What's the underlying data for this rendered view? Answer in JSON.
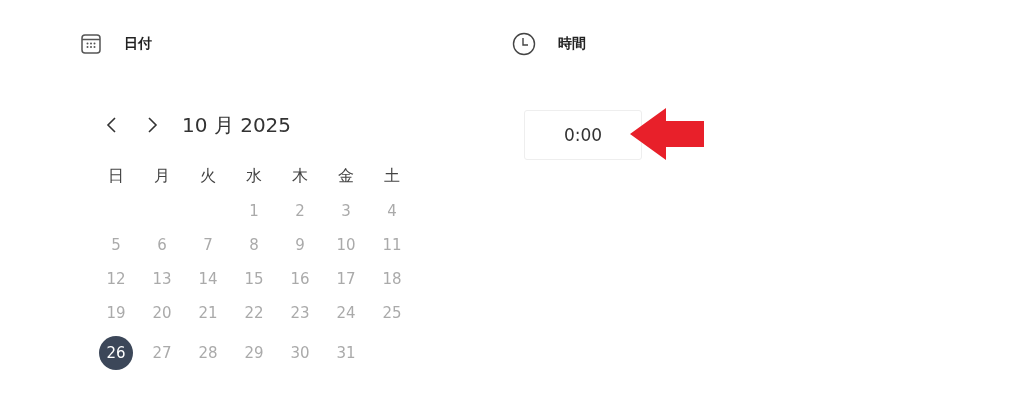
{
  "date_section": {
    "title": "日付",
    "month_label": "10 月 2025",
    "weekdays": [
      "日",
      "月",
      "火",
      "水",
      "木",
      "金",
      "土"
    ],
    "weeks": [
      [
        {
          "day": "1",
          "selected": false
        },
        {
          "day": "2",
          "selected": false
        },
        {
          "day": "3",
          "selected": false
        },
        {
          "day": "4",
          "selected": false
        }
      ],
      [
        {
          "day": "5",
          "selected": false
        },
        {
          "day": "6",
          "selected": false
        },
        {
          "day": "7",
          "selected": false
        },
        {
          "day": "8",
          "selected": false
        },
        {
          "day": "9",
          "selected": false
        },
        {
          "day": "10",
          "selected": false
        },
        {
          "day": "11",
          "selected": false
        }
      ],
      [
        {
          "day": "12",
          "selected": false
        },
        {
          "day": "13",
          "selected": false
        },
        {
          "day": "14",
          "selected": false
        },
        {
          "day": "15",
          "selected": false
        },
        {
          "day": "16",
          "selected": false
        },
        {
          "day": "17",
          "selected": false
        },
        {
          "day": "18",
          "selected": false
        }
      ],
      [
        {
          "day": "19",
          "selected": false
        },
        {
          "day": "20",
          "selected": false
        },
        {
          "day": "21",
          "selected": false
        },
        {
          "day": "22",
          "selected": false
        },
        {
          "day": "23",
          "selected": false
        },
        {
          "day": "24",
          "selected": false
        },
        {
          "day": "25",
          "selected": false
        }
      ],
      [
        {
          "day": "26",
          "selected": true
        },
        {
          "day": "27",
          "selected": false
        },
        {
          "day": "28",
          "selected": false
        },
        {
          "day": "29",
          "selected": false
        },
        {
          "day": "30",
          "selected": false
        },
        {
          "day": "31",
          "selected": false
        }
      ]
    ]
  },
  "time_section": {
    "title": "時間",
    "value": "0:00"
  }
}
